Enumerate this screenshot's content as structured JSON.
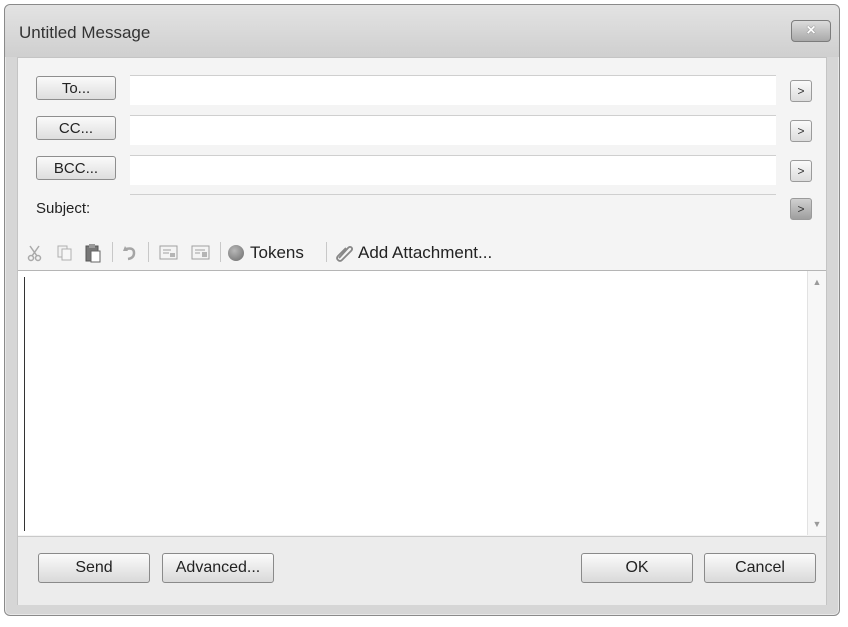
{
  "window": {
    "title": "Untitled Message",
    "close_glyph": "×"
  },
  "addresses": {
    "to_label": "To...",
    "cc_label": "CC...",
    "bcc_label": "BCC...",
    "to_value": "",
    "cc_value": "",
    "bcc_value": "",
    "expand_glyph": ">"
  },
  "subject": {
    "label": "Subject:",
    "value": "",
    "expand_glyph": ">"
  },
  "toolbar": {
    "tokens_label": "Tokens",
    "attachment_label": "Add Attachment...",
    "icons": [
      "cut-icon",
      "copy-icon",
      "paste-icon",
      "undo-icon",
      "insert-field-icon",
      "insert-block-icon",
      "tokens-icon",
      "paperclip-icon"
    ]
  },
  "editor": {
    "body": ""
  },
  "footer": {
    "send_label": "Send",
    "advanced_label": "Advanced...",
    "ok_label": "OK",
    "cancel_label": "Cancel"
  },
  "colors": {
    "window_bg": "#d6d6d6",
    "client_bg": "#f4f4f4",
    "editor_bg": "#ffffff"
  }
}
